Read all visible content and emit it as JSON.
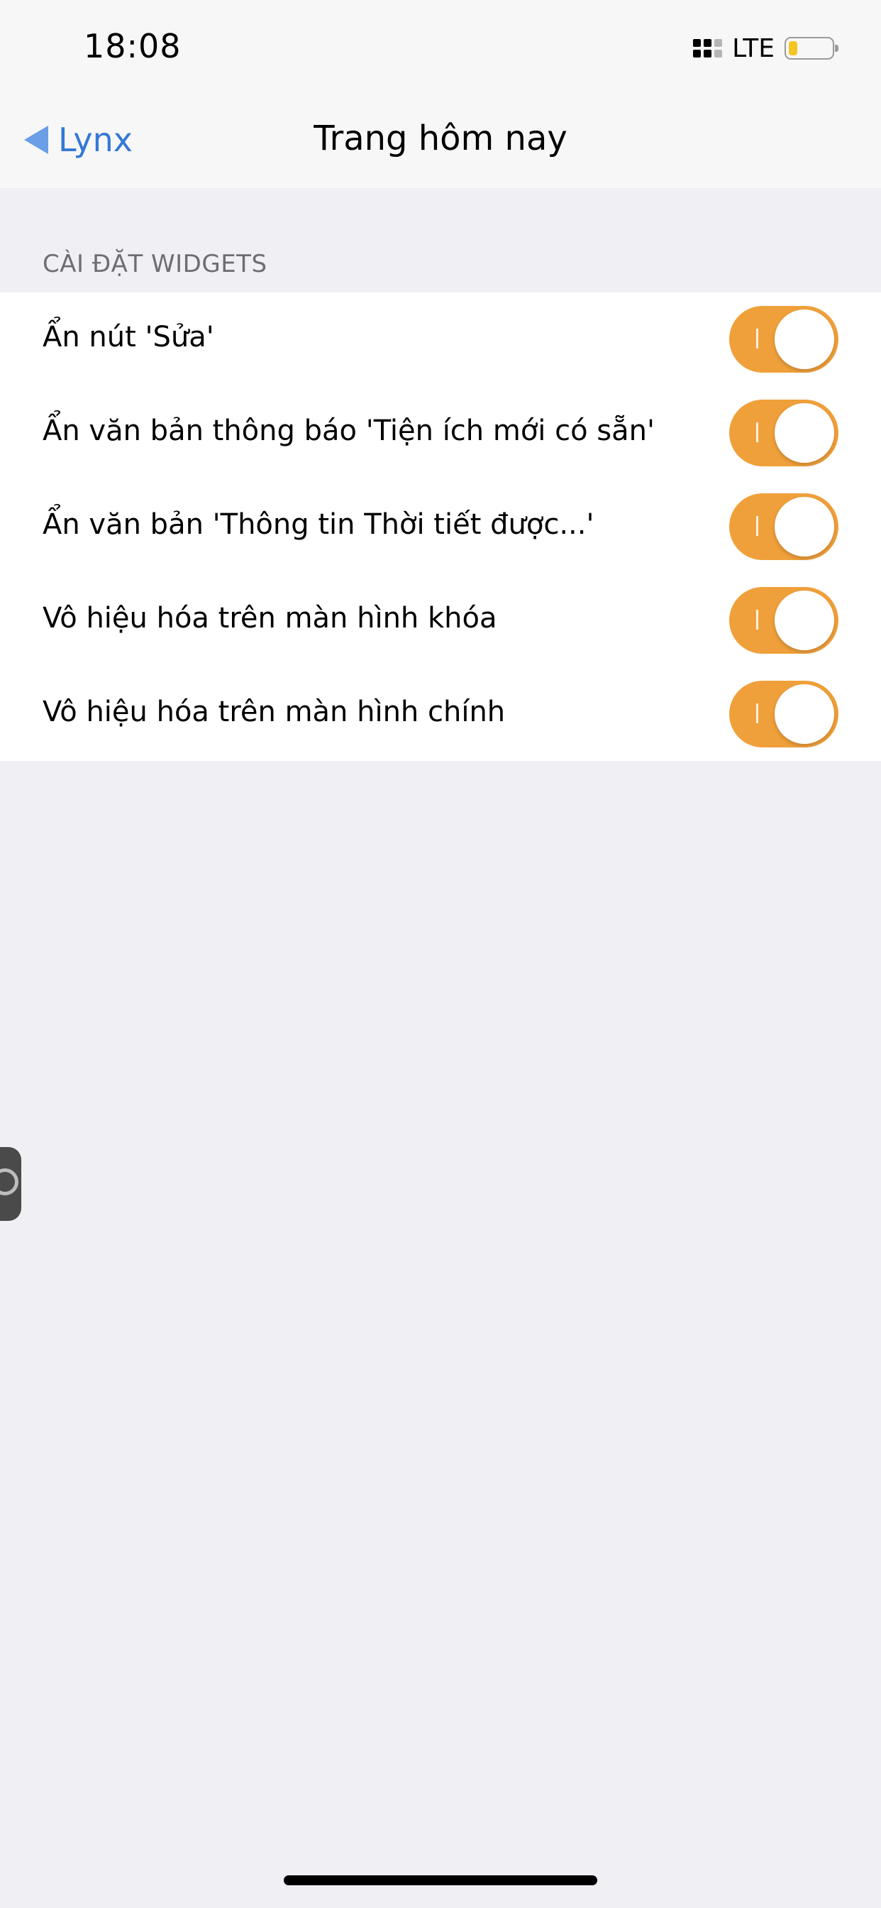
{
  "status_bar": {
    "time": "18:08",
    "network": "LTE",
    "icons": {
      "signal": "signal-bars-icon",
      "battery": "battery-low-icon"
    },
    "battery_color": "#f3c623"
  },
  "nav": {
    "back_label": "Lynx",
    "back_icon": "back-arrow-icon",
    "title": "Trang hôm nay"
  },
  "section": {
    "header": "CÀI ĐẶT WIDGETS"
  },
  "settings": [
    {
      "label": "Ẩn nút 'Sửa'",
      "enabled": true
    },
    {
      "label": "Ẩn văn bản thông báo 'Tiện ích mới có sẵn'",
      "enabled": true
    },
    {
      "label": "Ẩn văn bản 'Thông tin Thời tiết được...'",
      "enabled": true
    },
    {
      "label": "Vô hiệu hóa trên màn hình khóa",
      "enabled": true
    },
    {
      "label": "Vô hiệu hóa trên màn hình chính",
      "enabled": true
    }
  ],
  "colors": {
    "accent_toggle": "#f0a03a",
    "link": "#3478d6",
    "background": "#efeff4"
  }
}
